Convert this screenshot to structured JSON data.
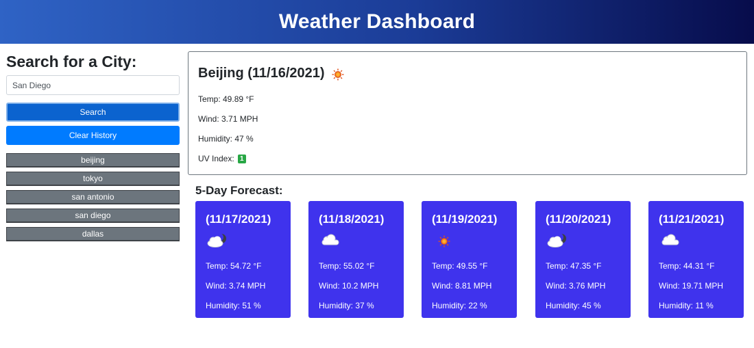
{
  "header": {
    "title": "Weather Dashboard"
  },
  "search": {
    "heading": "Search for a City:",
    "input_value": "San Diego",
    "search_label": "Search",
    "clear_label": "Clear History"
  },
  "history": [
    "beijing",
    "tokyo",
    "san antonio",
    "san diego",
    "dallas"
  ],
  "current": {
    "city_date": "Beijing (11/16/2021)",
    "icon": "sun-icon",
    "temp": "Temp: 49.89 °F",
    "wind": "Wind: 3.71 MPH",
    "humidity": "Humidity: 47 %",
    "uv_label": "UV Index:",
    "uv_value": "1",
    "uv_color": "#28a745"
  },
  "forecast": {
    "heading": "5-Day Forecast:",
    "card_color": "#3f33ed",
    "days": [
      {
        "date": "(11/17/2021)",
        "icon": "cloud-moon-icon",
        "temp": "Temp: 54.72 °F",
        "wind": "Wind: 3.74 MPH",
        "humidity": "Humidity: 51 %"
      },
      {
        "date": "(11/18/2021)",
        "icon": "cloud-icon",
        "temp": "Temp: 55.02 °F",
        "wind": "Wind: 10.2 MPH",
        "humidity": "Humidity: 37 %"
      },
      {
        "date": "(11/19/2021)",
        "icon": "sun-icon",
        "temp": "Temp: 49.55 °F",
        "wind": "Wind: 8.81 MPH",
        "humidity": "Humidity: 22 %"
      },
      {
        "date": "(11/20/2021)",
        "icon": "cloud-moon-icon",
        "temp": "Temp: 47.35 °F",
        "wind": "Wind: 3.76 MPH",
        "humidity": "Humidity: 45 %"
      },
      {
        "date": "(11/21/2021)",
        "icon": "cloud-icon",
        "temp": "Temp: 44.31 °F",
        "wind": "Wind: 19.71 MPH",
        "humidity": "Humidity: 11 %"
      }
    ]
  }
}
